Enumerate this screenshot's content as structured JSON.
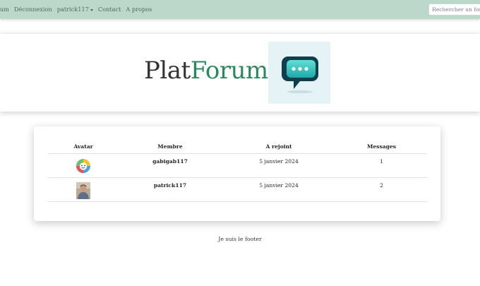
{
  "navbar": {
    "links": [
      {
        "label": "rum"
      },
      {
        "label": "Déconnexion"
      },
      {
        "label": "patrick117"
      },
      {
        "label": "Contact"
      },
      {
        "label": "A propos"
      }
    ],
    "search": {
      "placeholder": "Rechercher un forum"
    }
  },
  "header": {
    "brand_part1": "Plat",
    "brand_part2": "Forum",
    "logo_icon": "chat-bubble-icon"
  },
  "members_table": {
    "columns": [
      "Avatar",
      "Membre",
      "A rejoint",
      "Messages"
    ],
    "rows": [
      {
        "avatar": "avatar-gabigab",
        "member": "gabigab117",
        "joined": "5 janvier 2024",
        "messages": "1"
      },
      {
        "avatar": "avatar-patrick",
        "member": "patrick117",
        "joined": "5 janvier 2024",
        "messages": "2"
      }
    ]
  },
  "footer": {
    "text": "Je suis le footer"
  },
  "colors": {
    "navbar_bg": "#bcd8cb",
    "brand_accent": "#27895c"
  }
}
